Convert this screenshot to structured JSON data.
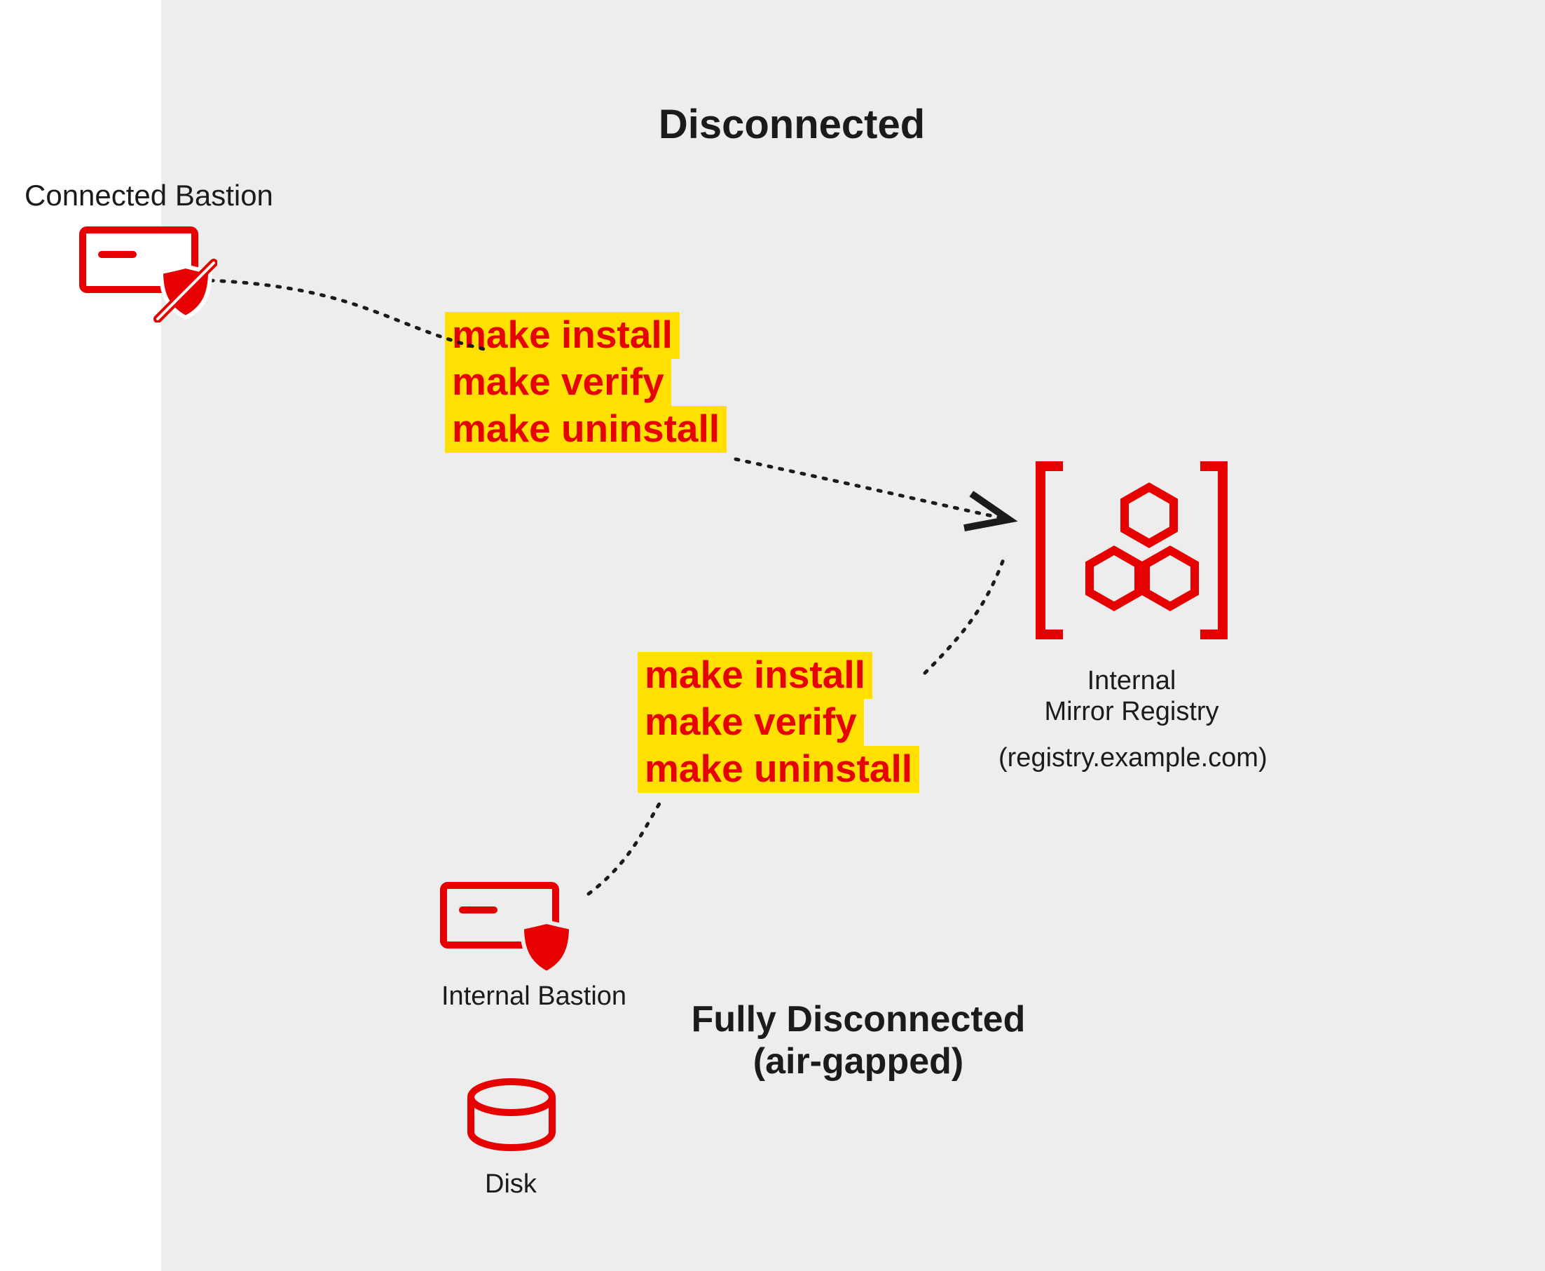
{
  "zones": {
    "disconnected_title": "Disconnected",
    "fully_disconnected_title_line1": "Fully Disconnected",
    "fully_disconnected_title_line2": "(air-gapped)"
  },
  "nodes": {
    "connected_bastion": {
      "label": "Connected Bastion"
    },
    "internal_bastion": {
      "label": "Internal Bastion"
    },
    "disk": {
      "label": "Disk"
    },
    "mirror_registry": {
      "label_line1": "Internal",
      "label_line2": "Mirror Registry",
      "hostname": "(registry.example.com)"
    }
  },
  "commands": {
    "block1": {
      "line1": "make install",
      "line2": "make verify",
      "line3": "make uninstall"
    },
    "block2": {
      "line1": "make install",
      "line2": "make verify",
      "line3": "make uninstall"
    }
  },
  "colors": {
    "red": "#e60000",
    "yellow": "#ffe000",
    "black": "#1b1b1b",
    "zone": "#ededed"
  }
}
